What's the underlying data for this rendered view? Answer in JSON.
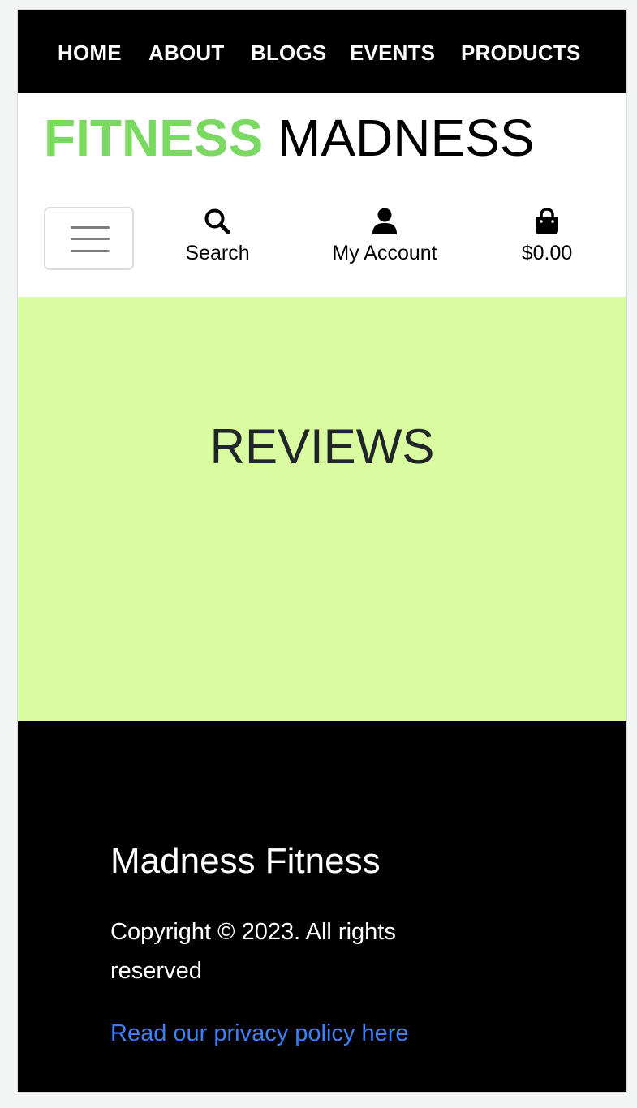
{
  "nav": {
    "items": [
      {
        "label": "HOME"
      },
      {
        "label": "ABOUT"
      },
      {
        "label": "BLOGS"
      },
      {
        "label": "EVENTS"
      },
      {
        "label": "PRODUCTS"
      }
    ]
  },
  "brand": {
    "part1": "FITNESS",
    "part2": "MADNESS",
    "colors": {
      "part1": "#79d960",
      "part2": "#000000"
    }
  },
  "toolbar": {
    "menu_icon": "hamburger-icon",
    "search": {
      "label": "Search",
      "icon": "search-icon"
    },
    "account": {
      "label": "My Account",
      "icon": "user-icon"
    },
    "cart": {
      "label": "$0.00",
      "icon": "shopping-bag-icon"
    }
  },
  "hero": {
    "title": "REVIEWS",
    "background": "#d8fc9f"
  },
  "footer": {
    "title": "Madness Fitness",
    "copyright": "Copyright © 2023. All rights reserved",
    "privacy_link": "Read our privacy policy here",
    "link_color": "#3d80f5"
  }
}
